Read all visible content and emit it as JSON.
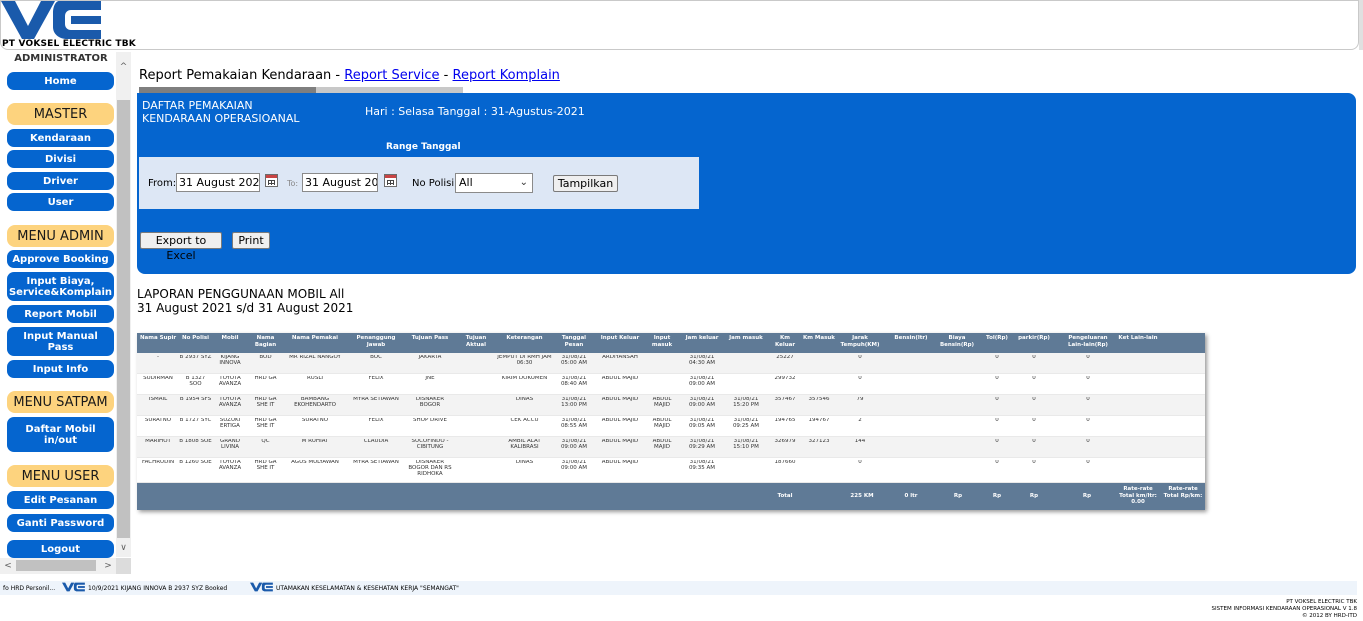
{
  "header": {
    "company": "PT VOKSEL ELECTRIC TBK"
  },
  "sidebar": {
    "admin_label": "ADMINISTRATOR",
    "home": "Home",
    "master_head": "MASTER",
    "master_items": [
      "Kendaraan",
      "Divisi",
      "Driver",
      "User"
    ],
    "admin_head": "MENU ADMIN",
    "admin_items": [
      "Approve Booking",
      "Input Biaya, Service&Komplain",
      "Report Mobil",
      "Input Manual Pass",
      "Input Info"
    ],
    "satpam_head": "MENU SATPAM",
    "satpam_items": [
      "Daftar Mobil in/out"
    ],
    "user_head": "MENU USER",
    "user_items": [
      "Edit Pesanan",
      "Ganti Password",
      "Logout"
    ]
  },
  "main": {
    "title_prefix": "Report Pemakaian Kendaraan",
    "sep1": " - ",
    "link_service": "Report Service",
    "sep2": " - ",
    "link_komplain": "Report Komplain"
  },
  "panel": {
    "title_line1": "DAFTAR PEMAKAIAN",
    "title_line2": "KENDARAAN OPERASIOANAL",
    "date_text": "Hari : Selasa  Tanggal : 31-Agustus-2021",
    "range_label": "Range Tanggal",
    "from_label": "From:",
    "from_value": "31 August 2021",
    "to_label": "To:",
    "to_value": "31 August 2021",
    "nopol_label": "No Polisi:",
    "nopol_value": "All",
    "show_button": "Tampilkan",
    "export_button": "Export to Excel",
    "print_button": "Print"
  },
  "report": {
    "heading_line1": "LAPORAN PENGGUNAAN MOBIL All",
    "heading_line2": "31 August 2021 s/d 31 August 2021"
  },
  "table": {
    "headers": [
      "Nama Supir",
      "No Polisi",
      "Mobil",
      "Nama Bagian",
      "Nama Pemakai",
      "Penanggung Jawab",
      "Tujuan Pass",
      "Tujuan Aktual",
      "Keterangan",
      "Tanggal Pesan",
      "Input Keluar",
      "Input masuk",
      "Jam keluar",
      "Jam masuk",
      "Km Keluar",
      "Km Masuk",
      "Jarak Tempuh(KM)",
      "Bensin(ltr)",
      "Biaya Bensin(Rp)",
      "Tol(Rp)",
      "parkir(Rp)",
      "Pengeluaran Lain-lain(Rp)",
      "Ket Lain-lain"
    ],
    "rows": [
      [
        "-",
        "B 2937 SYZ",
        "KIJANG INNOVA",
        "BOD",
        "MR RIZAL NANGOY",
        "BOC",
        "JAKARTA",
        "",
        "JEMPUT DI RMH JAM 06:30",
        "31/08/21 05:00 AM",
        "ARDIYANSAH",
        "",
        "31/08/21 04:30 AM",
        "",
        "25227",
        "",
        "0",
        "",
        "",
        "0",
        "0",
        "0",
        ""
      ],
      [
        "SUDIRMAN",
        "B 1327 SOO",
        "TOYOTA AVANZA",
        "HRD GA",
        "RUSLI",
        "FELIX",
        "JNE",
        "",
        "KIRIM DOKUMEN",
        "31/08/21 08:40 AM",
        "ABDUL MAJID",
        "",
        "31/08/21 09:00 AM",
        "",
        "299732",
        "",
        "0",
        "",
        "",
        "0",
        "0",
        "0",
        ""
      ],
      [
        "ISMAIL",
        "B 1954 SFS",
        "TOYOTA AVANZA",
        "HRD GA SHE IT",
        "BAMBANG EKOHENDARTO",
        "MYRA SETIAWAN",
        "DISNAKER BOGOR",
        "",
        "DINAS",
        "31/08/21 13:00 PM",
        "ABDUL MAJID",
        "ABDUL MAJID",
        "31/08/21 09:00 AM",
        "31/08/21 15:20 PM",
        "357467",
        "357546",
        "79",
        "",
        "",
        "0",
        "0",
        "0",
        ""
      ],
      [
        "SURATNO",
        "B 1727 SYC",
        "SUZUKI ERTIGA",
        "HRD GA SHE IT",
        "SURATNO",
        "FELIX",
        "SHOP DRIVE",
        "",
        "CEK ACCU",
        "31/08/21 08:55 AM",
        "ABDUL MAJID",
        "ABDUL MAJID",
        "31/08/21 09:05 AM",
        "31/08/21 09:25 AM",
        "194765",
        "194767",
        "2",
        "",
        "",
        "0",
        "0",
        "0",
        ""
      ],
      [
        "MARIHOT",
        "B 1808 SOE",
        "GRAND LIVINA",
        "QC",
        "M RUHIAT",
        "CLAUDIA",
        "SUCOFINDO - CIBITUNG",
        "",
        "AMBIL ALAT KALIBRASI",
        "31/08/21 09:00 AM",
        "ABDUL MAJID",
        "ABDUL MAJID",
        "31/08/21 09:29 AM",
        "31/08/21 15:10 PM",
        "326979",
        "327123",
        "144",
        "",
        "",
        "0",
        "0",
        "0",
        ""
      ],
      [
        "FACHRUDIN",
        "B 1260 SOE",
        "TOYOTA AVANZA",
        "HRD GA SHE IT",
        "AGUS MULYAWAN",
        "MYRA SETIAWAN",
        "DISNAKER BOGOR DAN RS RIDHOKA",
        "",
        "DINAS",
        "31/08/21 09:00 AM",
        "ABDUL MAJID",
        "",
        "31/08/21 09:35 AM",
        "",
        "187660",
        "",
        "0",
        "",
        "",
        "0",
        "0",
        "0",
        ""
      ]
    ],
    "footer": {
      "total_label": "Total",
      "total_km": "225 KM",
      "total_ltr": "0 ltr",
      "rp1": "Rp",
      "rp2": "Rp",
      "rp3": "Rp",
      "rp4": "Rp",
      "avg_km_ltr": "Rate-rate Total km/ltr: 0.00",
      "avg_rp_km": "Rate-rate Total Rp/km:"
    }
  },
  "footer": {
    "ticker1": "fo HRD Personil...",
    "ticker2": "10/9/2021 KIJANG INNOVA B 2937 SYZ Booked",
    "ticker3": "UTAMAKAN KESELAMATAN & KESEHATAN KERJA \"SEMANGAT\"",
    "copy1": "PT VOKSEL ELECTRIC TBK",
    "copy2": "SISTEM INFORMASI KENDARAAN OPERASIONAL V 1.8",
    "copy3": "© 2012 BY HRD-ITD"
  },
  "colors": {
    "brand_blue": "#0565cf",
    "menu_head": "#fdd37e",
    "table_head": "#5f7a96"
  }
}
